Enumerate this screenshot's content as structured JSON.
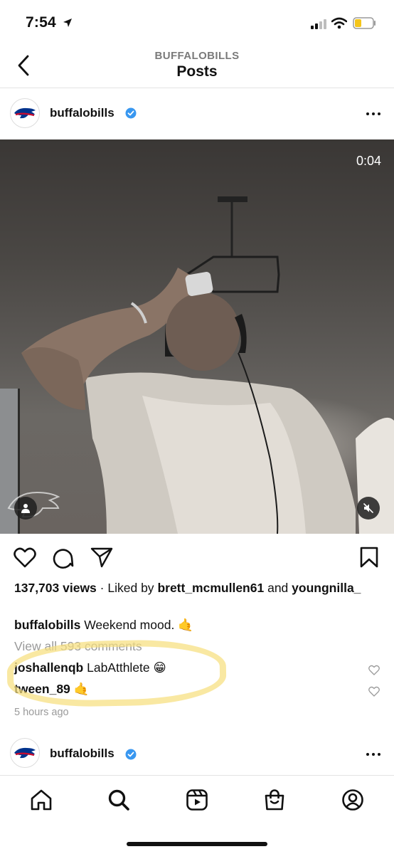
{
  "status_bar": {
    "time": "7:54"
  },
  "nav": {
    "account": "BUFFALOBILLS",
    "title": "Posts"
  },
  "post": {
    "username": "buffalobills",
    "video_timer": "0:04",
    "views_count": "137,703 views",
    "liked_by_prefix": "Liked by",
    "liked_by_user1": "brett_mcmullen61",
    "and_text": "and",
    "liked_by_user2": "youngnilla_",
    "caption_user": "buffalobills",
    "caption_text": "Weekend mood. 🤙",
    "view_all_comments": "View all 593 comments",
    "comments": [
      {
        "user": "joshallenqb",
        "text": "LabAtthlete 😁"
      },
      {
        "user": "tween_89",
        "text": "🤙"
      }
    ],
    "timestamp": "5 hours ago"
  },
  "next_post": {
    "username": "buffalobills"
  },
  "tabs": [
    "home-icon",
    "search-icon",
    "reels-icon",
    "shop-icon",
    "profile-icon"
  ],
  "colors": {
    "verified": "#3897f0",
    "highlight": "#f7df7e",
    "secondary_text": "#9a9a9a",
    "bills_red": "#c60c30",
    "bills_blue": "#00338d"
  }
}
